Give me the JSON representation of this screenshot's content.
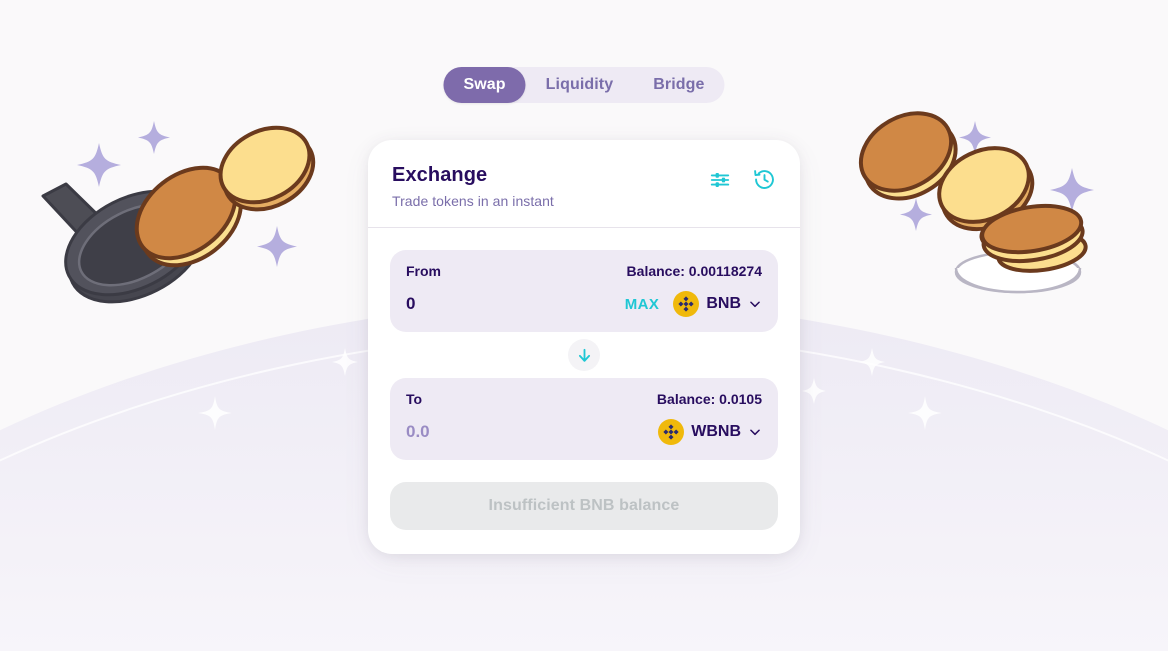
{
  "theme": {
    "page_background": "#faf9fa",
    "accent_teal": "#1fc7d4",
    "accent_purple": "#7e6bab",
    "text_dark_purple": "#280d5f",
    "text_muted_purple": "#7a6eaa",
    "panel_background": "#eeeaf4",
    "card_background": "#ffffff",
    "disabled_button_background": "#e9eaeb",
    "disabled_button_text": "#bdc2c4",
    "binance_yellow": "#f0b90b"
  },
  "tabs": [
    {
      "label": "Swap",
      "active": true
    },
    {
      "label": "Liquidity",
      "active": false
    },
    {
      "label": "Bridge",
      "active": false
    }
  ],
  "card": {
    "title": "Exchange",
    "subtitle": "Trade tokens in an instant",
    "icons": [
      {
        "name": "settings-sliders-icon",
        "label": "Settings"
      },
      {
        "name": "history-clock-icon",
        "label": "Recent transactions"
      }
    ]
  },
  "from_panel": {
    "label": "From",
    "balance_text": "Balance: 0.00118274",
    "balance_value": "0.00118274",
    "amount_value": "0",
    "amount_placeholder": "0.0",
    "max_label": "MAX",
    "token_symbol": "BNB",
    "token_icon": "binance-coin-icon",
    "chevron_icon": "chevron-down-icon"
  },
  "switch_button": {
    "icon": "arrow-down-icon",
    "label": "Switch tokens"
  },
  "to_panel": {
    "label": "To",
    "balance_text": "Balance: 0.0105",
    "balance_value": "0.0105",
    "amount_value": "",
    "amount_placeholder": "0.0",
    "token_symbol": "WBNB",
    "token_icon": "binance-coin-icon",
    "chevron_icon": "chevron-down-icon"
  },
  "cta": {
    "label": "Insufficient BNB balance",
    "disabled": true
  },
  "decorations": {
    "left": [
      "frying-pan",
      "pancake-flipping-brown",
      "pancake-yellow",
      "sparkles"
    ],
    "right": [
      "pancake-brown",
      "pancake-yellow",
      "pancake-stack-on-plate",
      "sparkles"
    ],
    "background_curve": "light-lavender-hill"
  }
}
